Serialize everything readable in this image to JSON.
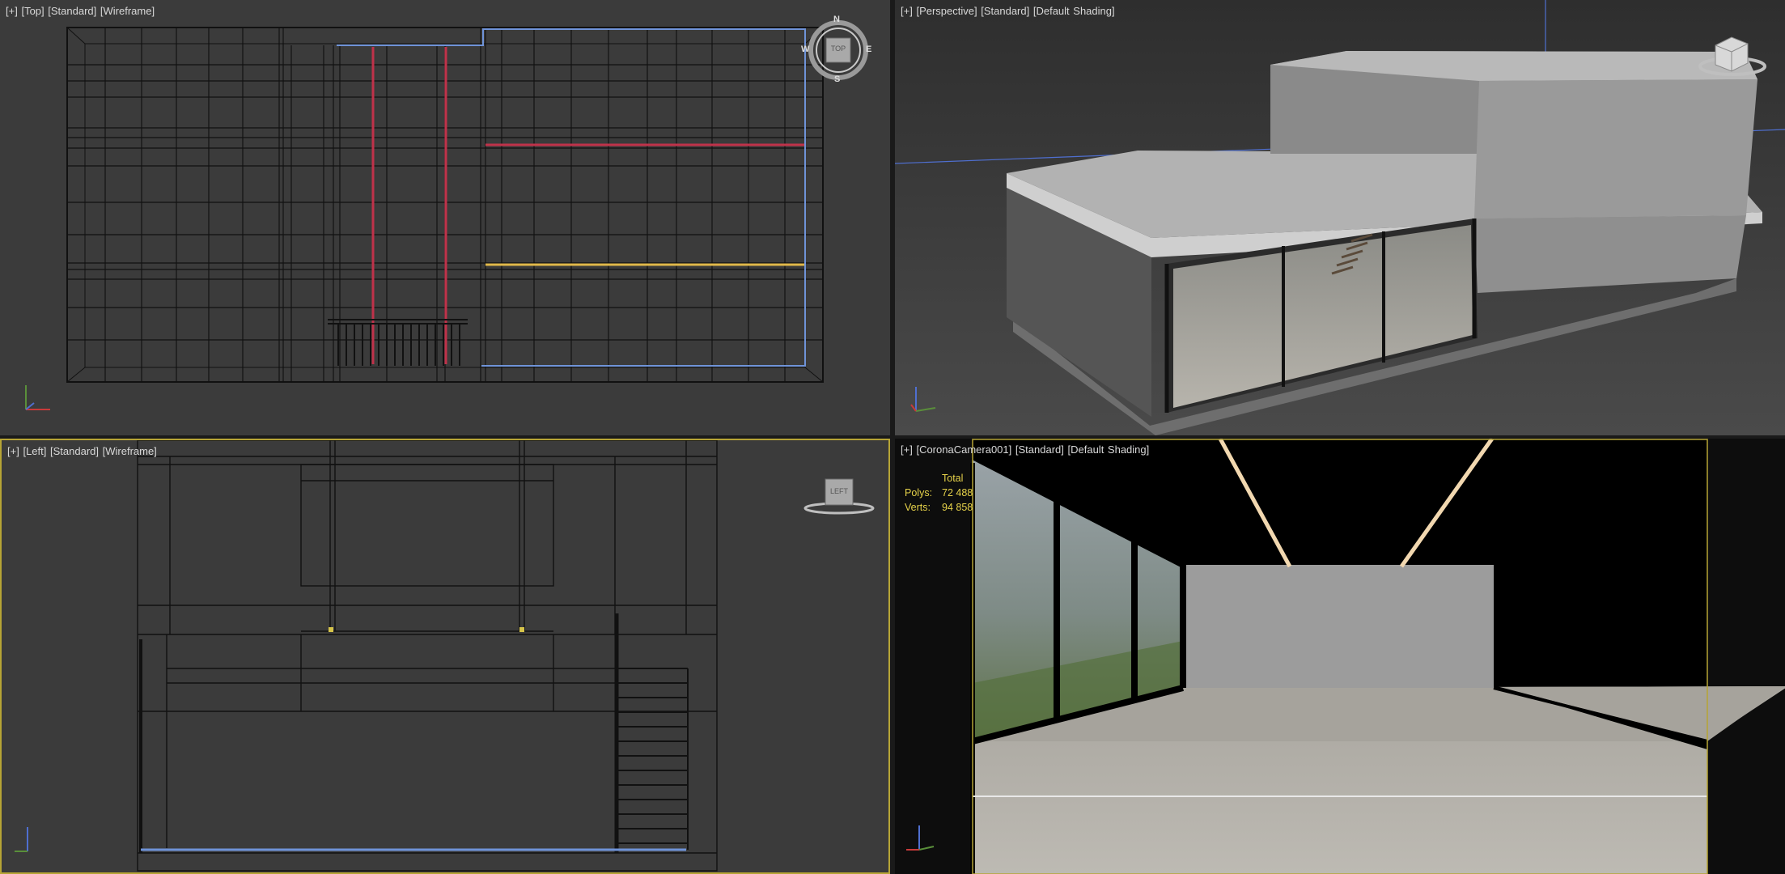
{
  "viewports": {
    "top": {
      "menu": "[+]",
      "view": "[Top]",
      "style": "[Standard]",
      "shading": "[Wireframe]",
      "gizmo": {
        "label": "TOP",
        "north": "N",
        "south": "S",
        "east": "E",
        "west": "W"
      }
    },
    "perspective": {
      "menu": "[+]",
      "view": "[Perspective]",
      "style": "[Standard]",
      "shading": "[Default Shading]",
      "gizmo_icon": "viewcube-icon"
    },
    "left": {
      "menu": "[+]",
      "view": "[Left]",
      "style": "[Standard]",
      "shading": "[Wireframe]",
      "gizmo": {
        "label": "LEFT"
      }
    },
    "camera": {
      "menu": "[+]",
      "view": "[CoronaCamera001]",
      "style": "[Standard]",
      "shading": "[Default Shading]",
      "stats": {
        "header": "Total",
        "polys_label": "Polys:",
        "polys_value": "72 488",
        "verts_label": "Verts:",
        "verts_value": "94 858"
      }
    }
  },
  "colors": {
    "viewport_bg": "#3b3b3b",
    "active_border": "#b6a435",
    "wire": "#111111",
    "selection_blue": "#6f93d8",
    "light_red": "#c0324a",
    "light_yellow": "#e0b84a",
    "stats_yellow": "#e6d24a"
  }
}
